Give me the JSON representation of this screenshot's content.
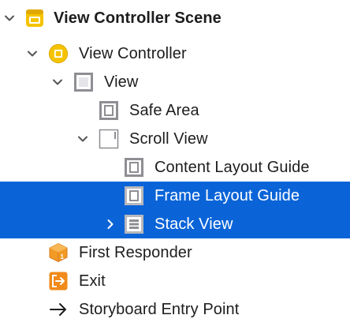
{
  "tree": {
    "scene": {
      "label": "View Controller Scene",
      "expanded": true,
      "icon": "storyboard-scene-icon"
    },
    "view_controller": {
      "label": "View Controller",
      "expanded": true,
      "icon": "view-controller-icon"
    },
    "view": {
      "label": "View",
      "expanded": true,
      "icon": "view-icon"
    },
    "safe_area": {
      "label": "Safe Area",
      "icon": "layout-guide-icon"
    },
    "scroll_view": {
      "label": "Scroll View",
      "expanded": true,
      "icon": "scroll-view-icon"
    },
    "content_layout_guide": {
      "label": "Content Layout Guide",
      "icon": "layout-guide-icon"
    },
    "frame_layout_guide": {
      "label": "Frame Layout Guide",
      "selected": true,
      "icon": "layout-guide-icon"
    },
    "stack_view": {
      "label": "Stack View",
      "selected": true,
      "expanded": false,
      "icon": "stack-view-icon"
    },
    "first_responder": {
      "label": "First Responder",
      "icon": "first-responder-cube-icon"
    },
    "exit": {
      "label": "Exit",
      "icon": "exit-icon"
    },
    "entry_point": {
      "label": "Storyboard Entry Point",
      "icon": "arrow-right-icon"
    }
  },
  "colors": {
    "selection": "#0a64d8",
    "scene_yellow": "#f5c300",
    "exit_orange": "#f08a1a",
    "cube_orange": "#f29a26",
    "icon_gray": "#8e8e93"
  }
}
